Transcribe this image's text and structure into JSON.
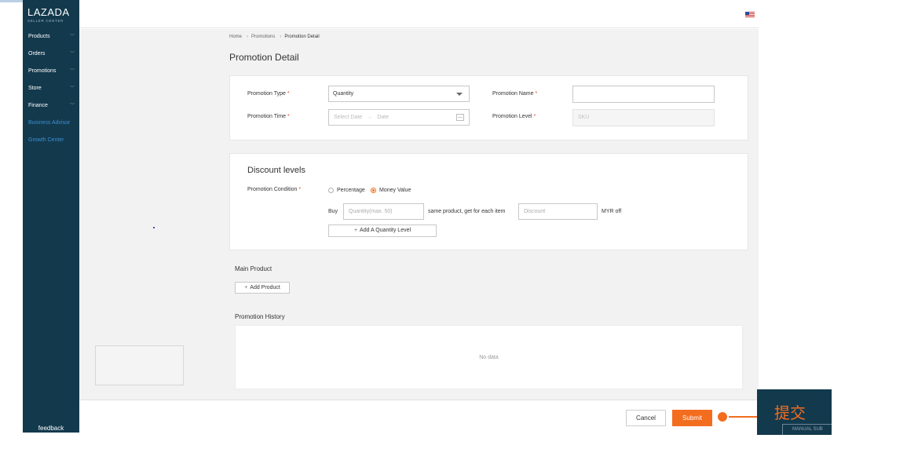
{
  "app": {
    "logo": "LAZADA",
    "logo_sub": "SELLER CENTER"
  },
  "sidebar": {
    "items": [
      {
        "label": "Products",
        "expandable": true
      },
      {
        "label": "Orders",
        "expandable": true
      },
      {
        "label": "Promotions",
        "expandable": true
      },
      {
        "label": "Store",
        "expandable": true
      },
      {
        "label": "Finance",
        "expandable": true
      },
      {
        "label": "Business Advisor",
        "expandable": false
      },
      {
        "label": "Growth Center",
        "expandable": false
      }
    ],
    "feedback": "feedback"
  },
  "header": {
    "flag_icon": "us-flag-icon"
  },
  "breadcrumb": [
    "Home",
    "Promotions",
    "Promotion Detail"
  ],
  "page_title": "Promotion Detail",
  "form": {
    "promotion_type_label": "Promotion Type",
    "promotion_type_value": "Quantity",
    "promotion_name_label": "Promotion Name",
    "promotion_name_value": "",
    "promotion_time_label": "Promotion Time",
    "start_placeholder": "Select Date",
    "range_separator": "→",
    "end_placeholder": "Date",
    "promotion_level_label": "Promotion Level",
    "promotion_level_value": "SKU",
    "required_mark": "*"
  },
  "discount": {
    "title": "Discount levels",
    "condition_label": "Promotion Condition",
    "options": [
      "Percentage",
      "Money Value"
    ],
    "selected": "Money Value",
    "buy_text": "Buy",
    "quantity_placeholder": "Quantity(max. 50)",
    "middle_text": "same product, get for each item",
    "discount_placeholder": "Discount",
    "unit_text": "MYR off",
    "add_level_label": "Add A Quantity Level"
  },
  "main_product": {
    "heading": "Main Product",
    "add_label": "Add Product"
  },
  "history": {
    "heading": "Promotion History",
    "empty_text": "No data"
  },
  "actions": {
    "cancel": "Cancel",
    "submit": "Submit"
  },
  "annotation": {
    "text": "提交",
    "inner_text": "MANUAL SUB"
  },
  "colors": {
    "sidebar_bg": "#13394d",
    "accent": "#f36d1f",
    "link": "#3c8fd0"
  }
}
